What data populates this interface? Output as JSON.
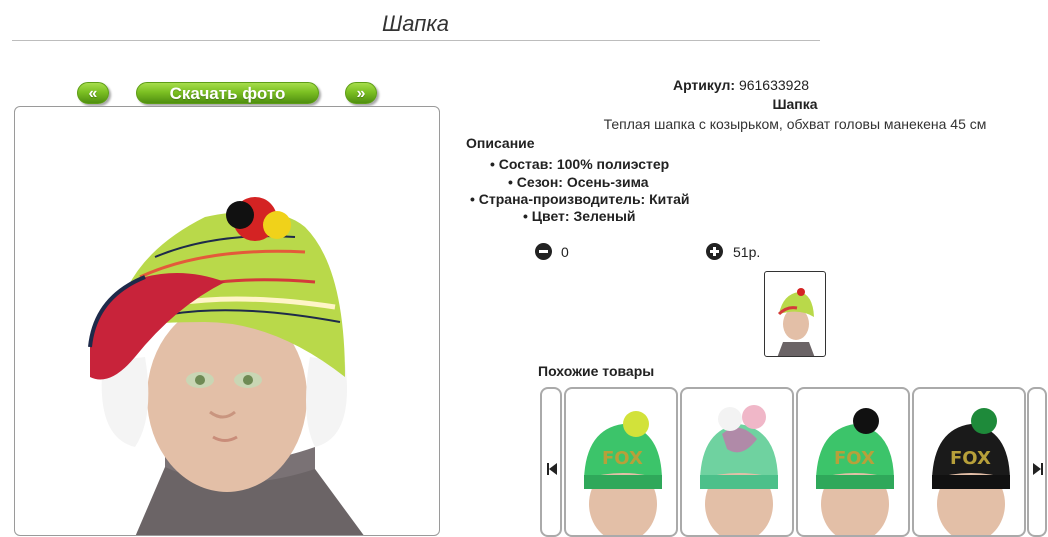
{
  "title": "Шапка",
  "photo_nav": {
    "prev_label": "«",
    "download_label": "Скачать фото",
    "next_label": "»"
  },
  "product": {
    "article_label": "Артикул:",
    "article_value": "961633928",
    "name": "Шапка",
    "short_desc": "Теплая шапка с козырьком, обхват головы манекена 45 см",
    "description_header": "Описание",
    "details": [
      "• Состав: 100% полиэстер",
      "• Сезон: Осень-зима",
      "• Страна-производитель: Китай",
      "• Цвет: Зеленый"
    ],
    "quantity": "0",
    "price": "51р."
  },
  "similar": {
    "title": "Похожие товары"
  },
  "colors": {
    "accent_green": "#7cc023",
    "frame_border": "#9a9a9a"
  },
  "icons": {
    "prev": "double-left-arrow-icon",
    "next": "double-right-arrow-icon",
    "minus": "minus-circle-icon",
    "plus": "plus-circle-icon",
    "carousel_prev": "skip-back-icon",
    "carousel_next": "skip-forward-icon"
  }
}
